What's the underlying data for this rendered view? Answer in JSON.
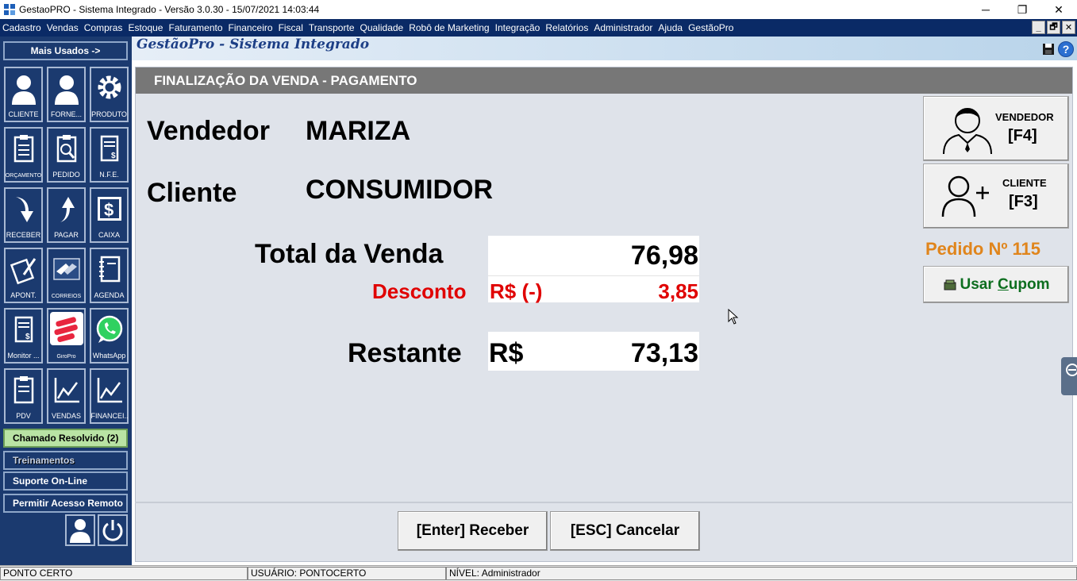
{
  "window": {
    "title": "GestaoPRO - Sistema Integrado - Versão 3.0.30 - 15/07/2021 14:03:44",
    "minimize": "─",
    "maximize": "❐",
    "close": "✕"
  },
  "menu": {
    "items": [
      "Cadastro",
      "Vendas",
      "Compras",
      "Estoque",
      "Faturamento",
      "Financeiro",
      "Fiscal",
      "Transporte",
      "Qualidade",
      "Robô de Marketing",
      "Integração",
      "Relatórios",
      "Administrador",
      "Ajuda",
      "GestãoPro"
    ],
    "mdi_min": "_",
    "mdi_restore": "🗗",
    "mdi_close": "✕"
  },
  "sidebar": {
    "mais_usados": "Mais Usados ->",
    "tiles": [
      "CLIENTE",
      "FORNE...",
      "PRODUTO",
      "ORÇAMENTO",
      "PEDIDO",
      "N.F.E.",
      "RECEBER",
      "PAGAR",
      "CAIXA",
      "APONT.",
      "CORREIOS",
      "AGENDA",
      "Monitor ...",
      "GiroPro",
      "WhatsApp",
      "PDV",
      "VENDAS",
      "FINANCEI..."
    ],
    "chamado": "Chamado Resolvido (2)",
    "treinamentos": "Treinamentos",
    "suporte": "Suporte On-Line",
    "acesso_remoto": "Permitir Acesso Remoto"
  },
  "header": {
    "brand": "GestãoPro - Sistema Integrado"
  },
  "payment": {
    "panel_title": "FINALIZAÇÃO DA VENDA - PAGAMENTO",
    "vendedor_label": "Vendedor",
    "vendedor_value": "MARIZA",
    "cliente_label": "Cliente",
    "cliente_value": "CONSUMIDOR",
    "total_label": "Total da Venda",
    "total_value": "76,98",
    "desconto_label": "Desconto",
    "desconto_currency": "R$ (-)",
    "desconto_value": "3,85",
    "restante_label": "Restante",
    "restante_currency": "R$",
    "restante_value": "73,13"
  },
  "actions": {
    "vendedor_caption": "VENDEDOR",
    "vendedor_key": "[F4]",
    "cliente_caption": "CLIENTE",
    "cliente_key": "[F3]",
    "pedido": "Pedido Nº 115",
    "cupom_pre": "Usar ",
    "cupom_underlined": "C",
    "cupom_post": "upom",
    "receber": "[Enter] Receber",
    "cancelar": "[ESC] Cancelar"
  },
  "status": {
    "company": "PONTO CERTO",
    "user": "USUÁRIO: PONTOCERTO",
    "level": "NÍVEL: Administrador"
  },
  "colors": {
    "sidebar": "#1b3a6f",
    "menubar": "#0a2a66",
    "pedido": "#e0851c",
    "desconto": "#e00000",
    "cupom": "#0d6e1f"
  }
}
